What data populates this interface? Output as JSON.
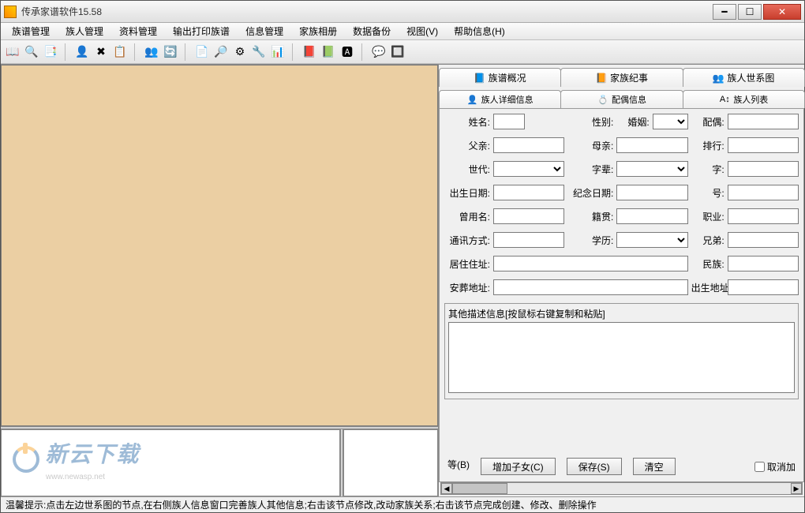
{
  "title": "传承家谱软件15.58",
  "menus": [
    "族谱管理",
    "族人管理",
    "资料管理",
    "输出打印族谱",
    "信息管理",
    "家族相册",
    "数据备份",
    "视图(V)",
    "帮助信息(H)"
  ],
  "toolbar_icons": [
    "📖",
    "🔍",
    "📑",
    "|",
    "👤",
    "✖",
    "📋",
    "|",
    "👥",
    "🔄",
    "|",
    "📄",
    "🔎",
    "⚙",
    "🔧",
    "📊",
    "|",
    "📕",
    "📗",
    "🅰",
    "|",
    "💬",
    "🔲"
  ],
  "tabs_top": [
    {
      "icon": "📘",
      "label": "族谱概况"
    },
    {
      "icon": "📙",
      "label": "家族纪事"
    },
    {
      "icon": "👥",
      "label": "族人世系图"
    }
  ],
  "tabs_sub": [
    {
      "icon": "👤",
      "label": "族人详细信息"
    },
    {
      "icon": "💍",
      "label": "配偶信息"
    },
    {
      "icon": "A↕",
      "label": "族人列表"
    }
  ],
  "labels": {
    "name": "姓名:",
    "gender": "性别:",
    "marriage": "婚姻:",
    "spouse": "配偶:",
    "father": "父亲:",
    "mother": "母亲:",
    "rank": "排行:",
    "gen": "世代:",
    "zibei": "字辈:",
    "zi": "字:",
    "birth": "出生日期:",
    "memdate": "纪念日期:",
    "hao": "号:",
    "usedname": "曾用名:",
    "native": "籍贯:",
    "job": "职业:",
    "contact": "通讯方式:",
    "edu": "学历:",
    "brothers": "兄弟:",
    "addr": "居住住址:",
    "ethnic": "民族:",
    "burial": "安葬地址:",
    "birthplace": "出生地址:"
  },
  "desc_legend": "其他描述信息[按鼠标右键复制和粘贴]",
  "buttons": {
    "b": "等(B)",
    "addchild": "增加子女(C)",
    "save": "保存(S)",
    "clear": "清空"
  },
  "checkbox": "取消加",
  "status": "温馨提示:点击左边世系图的节点,在右侧族人信息窗口完善族人其他信息;右击该节点修改,改动家族关系;右击该节点完成创建、修改、删除操作",
  "watermark": {
    "main": "新云下载",
    "sub": "www.newasp.net"
  }
}
